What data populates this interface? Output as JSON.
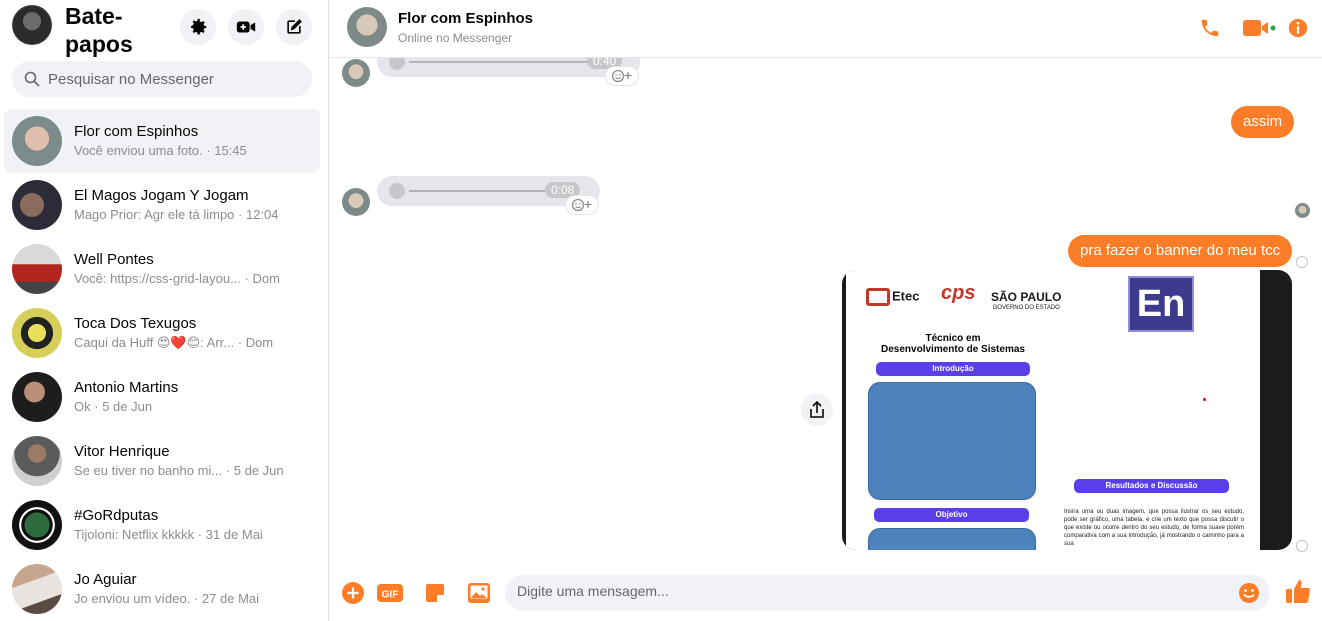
{
  "sidebar": {
    "title": "Bate-papos",
    "search_placeholder": "Pesquisar no Messenger",
    "conversations": [
      {
        "name": "Flor com Espinhos",
        "preview": "Você enviou uma foto.",
        "time": "· 15:45"
      },
      {
        "name": "El Magos Jogam Y Jogam",
        "preview": "Mago Prior: Agr ele tá limpo",
        "time": "· 12:04"
      },
      {
        "name": "Well Pontes",
        "preview": "Você: https://css-grid-layou...",
        "time": "· Dom"
      },
      {
        "name": "Toca Dos Texugos",
        "preview": "Caqui da Huff 😍❤️😊: Arr...",
        "time": "· Dom"
      },
      {
        "name": "Antonio Martins",
        "preview": "Ok",
        "time": "· 5 de Jun"
      },
      {
        "name": "Vitor Henrique",
        "preview": "Se eu tiver no banho mi...",
        "time": "· 5 de Jun"
      },
      {
        "name": "#GoRdputas",
        "preview": "Tijoloni: Netflix kkkkk",
        "time": "· 31 de Mai"
      },
      {
        "name": "Jo Aguiar",
        "preview": "Jo enviou um vídeo.",
        "time": "· 27 de Mai"
      }
    ]
  },
  "header": {
    "name": "Flor com Espinhos",
    "status": "Online no Messenger"
  },
  "chat": {
    "audio1_duration": "0:40",
    "audio2_duration": "0:08",
    "out_msg1": "assim",
    "out_msg2": "pra fazer o banner do meu tcc",
    "banner": {
      "logo_etec": "Etec",
      "logo_cps": "cps",
      "logo_sp": "SÃO PAULO",
      "logo_sp_sub": "GOVERNO DO ESTADO",
      "en_logo": "En",
      "title_line1": "Técnico em",
      "title_line2": "Desenvolvimento de Sistemas",
      "pill_intro": "Introdução",
      "pill_objetivo": "Objetivo",
      "pill_resultados": "Resultados e Discussão",
      "body_text": "Insira uma ou duas imagem, que possa ilustrar os seu estudo, pode ser gráfico, uma tabela, e crie um texto que possa discutir o que existe ou ocorre dentro do seu estudo, de forma suave porém comparativa com a sua introdução, já mostrando o caminho para a sua"
    }
  },
  "composer": {
    "placeholder": "Digite uma mensagem...",
    "gif_label": "GIF"
  },
  "colors": {
    "accent": "#fc7d28",
    "online": "#31a24c"
  }
}
